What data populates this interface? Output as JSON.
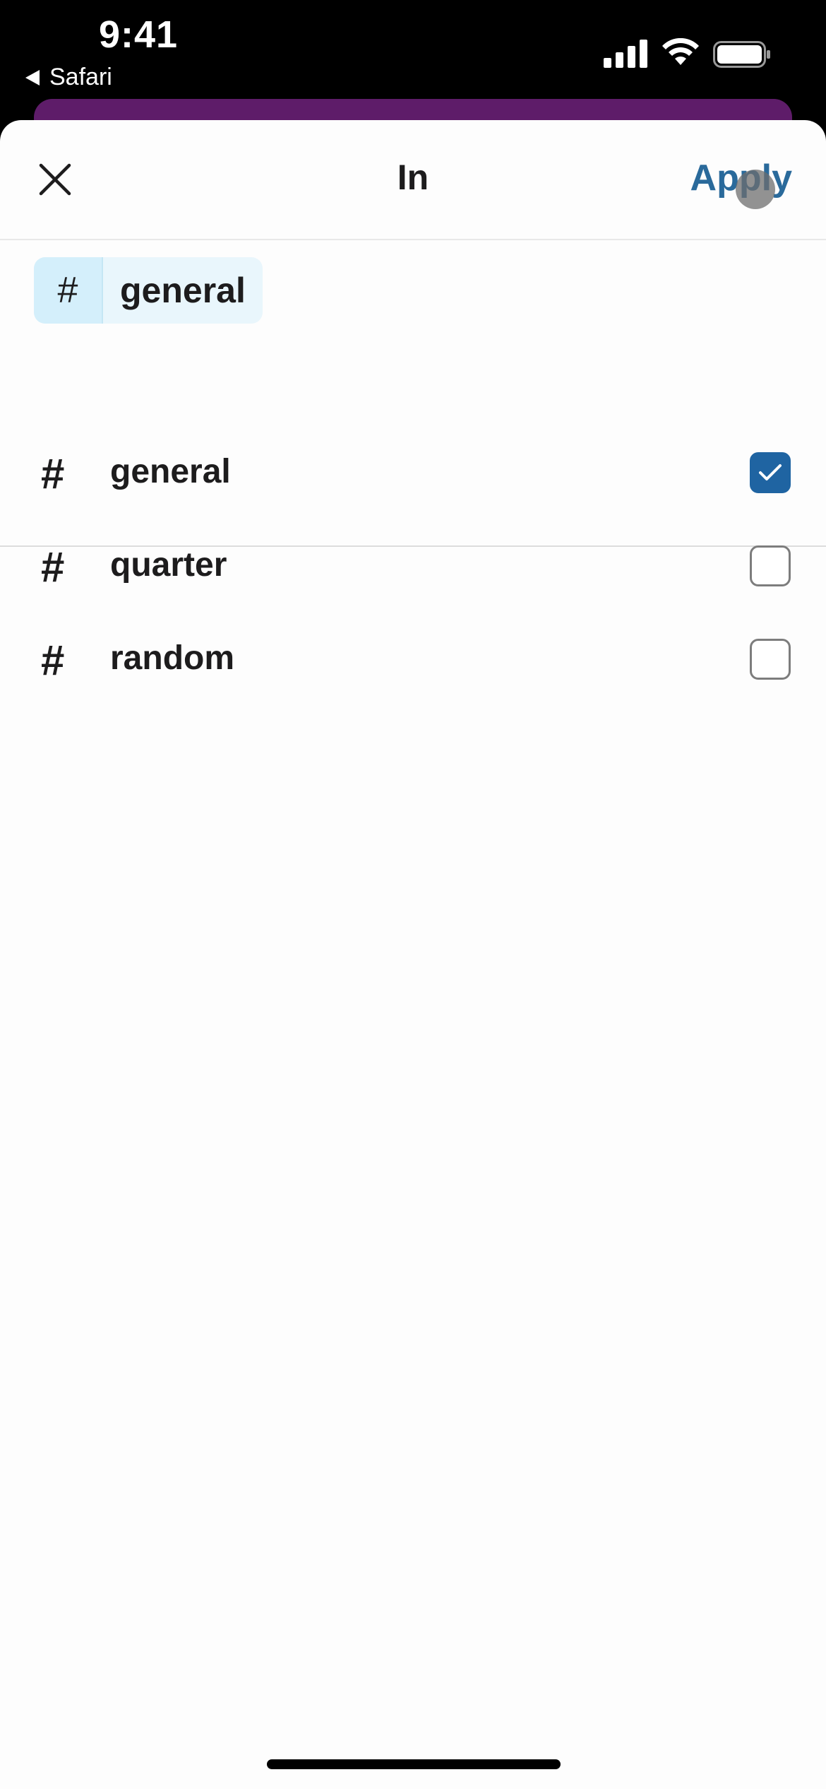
{
  "status_bar": {
    "time": "9:41",
    "back_app": "Safari",
    "signal_icon": "cellular-signal-icon",
    "wifi_icon": "wifi-icon",
    "battery_icon": "battery-icon"
  },
  "header": {
    "title": "In",
    "apply_label": "Apply",
    "close_icon": "close-icon"
  },
  "selected_chips": [
    {
      "prefix": "#",
      "label": "general"
    }
  ],
  "channels": [
    {
      "hash": "#",
      "name": "general",
      "checked": true
    },
    {
      "hash": "#",
      "name": "quarter",
      "checked": false
    },
    {
      "hash": "#",
      "name": "random",
      "checked": false
    }
  ],
  "colors": {
    "accent": "#2a6a9b",
    "checkbox_checked": "#1f64a2",
    "brand_purple": "#5e1c69",
    "chip_background": "#e9f6fc"
  }
}
